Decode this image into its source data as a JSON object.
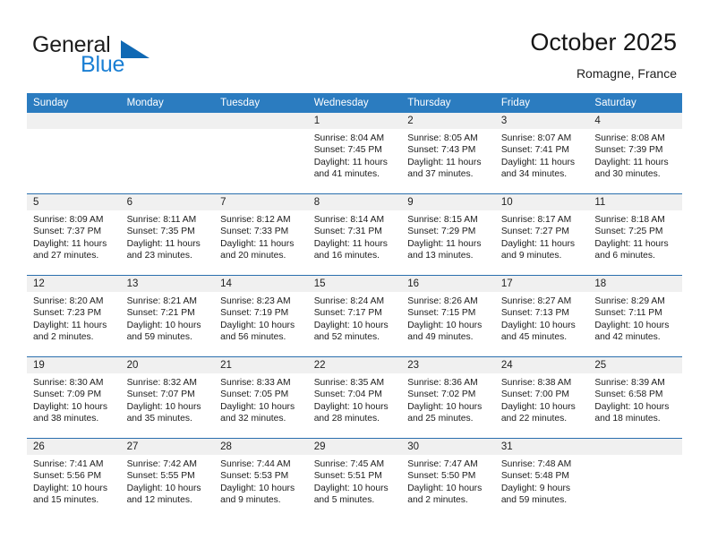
{
  "brand": {
    "word_one": "General",
    "word_two": "Blue",
    "triangle_icon": "brand-triangle-icon",
    "accent_color": "#1069b4",
    "blue_text_color": "#1a7fd4"
  },
  "header": {
    "title": "October 2025",
    "location": "Romagne, France"
  },
  "theme": {
    "header_blue": "#2b7cc0",
    "row_divider_blue": "#2b6fae",
    "daynum_band": "#f0f0f0",
    "cell_background": "#ffffff",
    "text": "#1c1c1c"
  },
  "weekdays": [
    "Sunday",
    "Monday",
    "Tuesday",
    "Wednesday",
    "Thursday",
    "Friday",
    "Saturday"
  ],
  "weeks": [
    [
      {
        "day": "",
        "empty": true,
        "sunrise": "",
        "sunset": "",
        "daylight_line1": "",
        "daylight_line2": ""
      },
      {
        "day": "",
        "empty": true,
        "sunrise": "",
        "sunset": "",
        "daylight_line1": "",
        "daylight_line2": ""
      },
      {
        "day": "",
        "empty": true,
        "sunrise": "",
        "sunset": "",
        "daylight_line1": "",
        "daylight_line2": ""
      },
      {
        "day": "1",
        "empty": false,
        "sunrise": "Sunrise: 8:04 AM",
        "sunset": "Sunset: 7:45 PM",
        "daylight_line1": "Daylight: 11 hours",
        "daylight_line2": "and 41 minutes."
      },
      {
        "day": "2",
        "empty": false,
        "sunrise": "Sunrise: 8:05 AM",
        "sunset": "Sunset: 7:43 PM",
        "daylight_line1": "Daylight: 11 hours",
        "daylight_line2": "and 37 minutes."
      },
      {
        "day": "3",
        "empty": false,
        "sunrise": "Sunrise: 8:07 AM",
        "sunset": "Sunset: 7:41 PM",
        "daylight_line1": "Daylight: 11 hours",
        "daylight_line2": "and 34 minutes."
      },
      {
        "day": "4",
        "empty": false,
        "sunrise": "Sunrise: 8:08 AM",
        "sunset": "Sunset: 7:39 PM",
        "daylight_line1": "Daylight: 11 hours",
        "daylight_line2": "and 30 minutes."
      }
    ],
    [
      {
        "day": "5",
        "empty": false,
        "sunrise": "Sunrise: 8:09 AM",
        "sunset": "Sunset: 7:37 PM",
        "daylight_line1": "Daylight: 11 hours",
        "daylight_line2": "and 27 minutes."
      },
      {
        "day": "6",
        "empty": false,
        "sunrise": "Sunrise: 8:11 AM",
        "sunset": "Sunset: 7:35 PM",
        "daylight_line1": "Daylight: 11 hours",
        "daylight_line2": "and 23 minutes."
      },
      {
        "day": "7",
        "empty": false,
        "sunrise": "Sunrise: 8:12 AM",
        "sunset": "Sunset: 7:33 PM",
        "daylight_line1": "Daylight: 11 hours",
        "daylight_line2": "and 20 minutes."
      },
      {
        "day": "8",
        "empty": false,
        "sunrise": "Sunrise: 8:14 AM",
        "sunset": "Sunset: 7:31 PM",
        "daylight_line1": "Daylight: 11 hours",
        "daylight_line2": "and 16 minutes."
      },
      {
        "day": "9",
        "empty": false,
        "sunrise": "Sunrise: 8:15 AM",
        "sunset": "Sunset: 7:29 PM",
        "daylight_line1": "Daylight: 11 hours",
        "daylight_line2": "and 13 minutes."
      },
      {
        "day": "10",
        "empty": false,
        "sunrise": "Sunrise: 8:17 AM",
        "sunset": "Sunset: 7:27 PM",
        "daylight_line1": "Daylight: 11 hours",
        "daylight_line2": "and 9 minutes."
      },
      {
        "day": "11",
        "empty": false,
        "sunrise": "Sunrise: 8:18 AM",
        "sunset": "Sunset: 7:25 PM",
        "daylight_line1": "Daylight: 11 hours",
        "daylight_line2": "and 6 minutes."
      }
    ],
    [
      {
        "day": "12",
        "empty": false,
        "sunrise": "Sunrise: 8:20 AM",
        "sunset": "Sunset: 7:23 PM",
        "daylight_line1": "Daylight: 11 hours",
        "daylight_line2": "and 2 minutes."
      },
      {
        "day": "13",
        "empty": false,
        "sunrise": "Sunrise: 8:21 AM",
        "sunset": "Sunset: 7:21 PM",
        "daylight_line1": "Daylight: 10 hours",
        "daylight_line2": "and 59 minutes."
      },
      {
        "day": "14",
        "empty": false,
        "sunrise": "Sunrise: 8:23 AM",
        "sunset": "Sunset: 7:19 PM",
        "daylight_line1": "Daylight: 10 hours",
        "daylight_line2": "and 56 minutes."
      },
      {
        "day": "15",
        "empty": false,
        "sunrise": "Sunrise: 8:24 AM",
        "sunset": "Sunset: 7:17 PM",
        "daylight_line1": "Daylight: 10 hours",
        "daylight_line2": "and 52 minutes."
      },
      {
        "day": "16",
        "empty": false,
        "sunrise": "Sunrise: 8:26 AM",
        "sunset": "Sunset: 7:15 PM",
        "daylight_line1": "Daylight: 10 hours",
        "daylight_line2": "and 49 minutes."
      },
      {
        "day": "17",
        "empty": false,
        "sunrise": "Sunrise: 8:27 AM",
        "sunset": "Sunset: 7:13 PM",
        "daylight_line1": "Daylight: 10 hours",
        "daylight_line2": "and 45 minutes."
      },
      {
        "day": "18",
        "empty": false,
        "sunrise": "Sunrise: 8:29 AM",
        "sunset": "Sunset: 7:11 PM",
        "daylight_line1": "Daylight: 10 hours",
        "daylight_line2": "and 42 minutes."
      }
    ],
    [
      {
        "day": "19",
        "empty": false,
        "sunrise": "Sunrise: 8:30 AM",
        "sunset": "Sunset: 7:09 PM",
        "daylight_line1": "Daylight: 10 hours",
        "daylight_line2": "and 38 minutes."
      },
      {
        "day": "20",
        "empty": false,
        "sunrise": "Sunrise: 8:32 AM",
        "sunset": "Sunset: 7:07 PM",
        "daylight_line1": "Daylight: 10 hours",
        "daylight_line2": "and 35 minutes."
      },
      {
        "day": "21",
        "empty": false,
        "sunrise": "Sunrise: 8:33 AM",
        "sunset": "Sunset: 7:05 PM",
        "daylight_line1": "Daylight: 10 hours",
        "daylight_line2": "and 32 minutes."
      },
      {
        "day": "22",
        "empty": false,
        "sunrise": "Sunrise: 8:35 AM",
        "sunset": "Sunset: 7:04 PM",
        "daylight_line1": "Daylight: 10 hours",
        "daylight_line2": "and 28 minutes."
      },
      {
        "day": "23",
        "empty": false,
        "sunrise": "Sunrise: 8:36 AM",
        "sunset": "Sunset: 7:02 PM",
        "daylight_line1": "Daylight: 10 hours",
        "daylight_line2": "and 25 minutes."
      },
      {
        "day": "24",
        "empty": false,
        "sunrise": "Sunrise: 8:38 AM",
        "sunset": "Sunset: 7:00 PM",
        "daylight_line1": "Daylight: 10 hours",
        "daylight_line2": "and 22 minutes."
      },
      {
        "day": "25",
        "empty": false,
        "sunrise": "Sunrise: 8:39 AM",
        "sunset": "Sunset: 6:58 PM",
        "daylight_line1": "Daylight: 10 hours",
        "daylight_line2": "and 18 minutes."
      }
    ],
    [
      {
        "day": "26",
        "empty": false,
        "sunrise": "Sunrise: 7:41 AM",
        "sunset": "Sunset: 5:56 PM",
        "daylight_line1": "Daylight: 10 hours",
        "daylight_line2": "and 15 minutes."
      },
      {
        "day": "27",
        "empty": false,
        "sunrise": "Sunrise: 7:42 AM",
        "sunset": "Sunset: 5:55 PM",
        "daylight_line1": "Daylight: 10 hours",
        "daylight_line2": "and 12 minutes."
      },
      {
        "day": "28",
        "empty": false,
        "sunrise": "Sunrise: 7:44 AM",
        "sunset": "Sunset: 5:53 PM",
        "daylight_line1": "Daylight: 10 hours",
        "daylight_line2": "and 9 minutes."
      },
      {
        "day": "29",
        "empty": false,
        "sunrise": "Sunrise: 7:45 AM",
        "sunset": "Sunset: 5:51 PM",
        "daylight_line1": "Daylight: 10 hours",
        "daylight_line2": "and 5 minutes."
      },
      {
        "day": "30",
        "empty": false,
        "sunrise": "Sunrise: 7:47 AM",
        "sunset": "Sunset: 5:50 PM",
        "daylight_line1": "Daylight: 10 hours",
        "daylight_line2": "and 2 minutes."
      },
      {
        "day": "31",
        "empty": false,
        "sunrise": "Sunrise: 7:48 AM",
        "sunset": "Sunset: 5:48 PM",
        "daylight_line1": "Daylight: 9 hours",
        "daylight_line2": "and 59 minutes."
      },
      {
        "day": "",
        "empty": true,
        "sunrise": "",
        "sunset": "",
        "daylight_line1": "",
        "daylight_line2": ""
      }
    ]
  ]
}
